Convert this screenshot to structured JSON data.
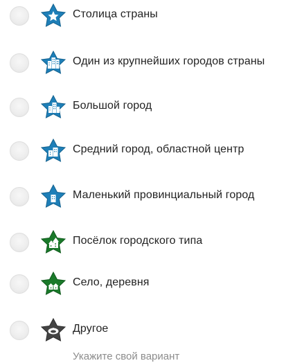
{
  "options": [
    {
      "label": "Столица страны",
      "icon": "star-capital-icon",
      "color": "#1e7fb8"
    },
    {
      "label": "Один из крупнейших городов страны",
      "icon": "star-large-city-icon",
      "color": "#1e7fb8"
    },
    {
      "label": "Большой город",
      "icon": "star-big-city-icon",
      "color": "#1e7fb8"
    },
    {
      "label": "Средний город, областной центр",
      "icon": "star-medium-city-icon",
      "color": "#1e7fb8"
    },
    {
      "label": "Маленький провинциальный город",
      "icon": "star-small-town-icon",
      "color": "#1e7fb8"
    },
    {
      "label": "Посёлок городского типа",
      "icon": "star-settlement-icon",
      "color": "#1a7a2a"
    },
    {
      "label": "Село, деревня",
      "icon": "star-village-icon",
      "color": "#1a7a2a"
    },
    {
      "label": "Другое",
      "icon": "star-other-icon",
      "color": "#444444"
    }
  ],
  "custom": {
    "placeholder": "Укажите свой вариант",
    "value": ""
  }
}
